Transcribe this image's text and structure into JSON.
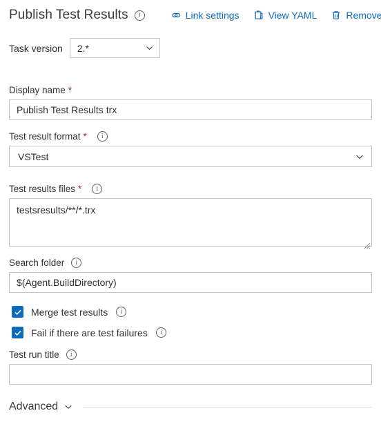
{
  "header": {
    "title": "Publish Test Results",
    "info_icon": "info-icon",
    "actions": [
      {
        "label": "Link settings",
        "icon": "link-icon"
      },
      {
        "label": "View YAML",
        "icon": "clipboard-icon"
      },
      {
        "label": "Remove",
        "icon": "trash-icon"
      }
    ]
  },
  "task_version": {
    "label": "Task version",
    "value": "2.*",
    "chevron_icon": "chevron-down-icon"
  },
  "fields": {
    "display_name": {
      "label": "Display name",
      "required": "*",
      "value": "Publish Test Results trx",
      "placeholder": ""
    },
    "test_result_format": {
      "label": "Test result format",
      "required": "*",
      "value": "VSTest",
      "info_icon": "info-icon",
      "chevron_icon": "chevron-down-icon"
    },
    "test_results_files": {
      "label": "Test results files",
      "required": "*",
      "value": "testsresults/**/*.trx",
      "placeholder": "",
      "info_icon": "info-icon"
    },
    "search_folder": {
      "label": "Search folder",
      "value": "$(Agent.BuildDirectory)",
      "placeholder": "",
      "info_icon": "info-icon"
    },
    "test_run_title": {
      "label": "Test run title",
      "value": "",
      "placeholder": "",
      "info_icon": "info-icon"
    }
  },
  "checkboxes": [
    {
      "label": "Merge test results",
      "checked": true,
      "info_icon": "info-icon"
    },
    {
      "label": "Fail if there are test failures",
      "checked": true,
      "info_icon": "info-icon"
    }
  ],
  "advanced": {
    "label": "Advanced",
    "chevron_icon": "chevron-down-icon"
  },
  "colors": {
    "accent": "#0f6cbd",
    "required_asterisk": "#a4262c",
    "border": "#c8c6c4",
    "text": "#323130"
  }
}
